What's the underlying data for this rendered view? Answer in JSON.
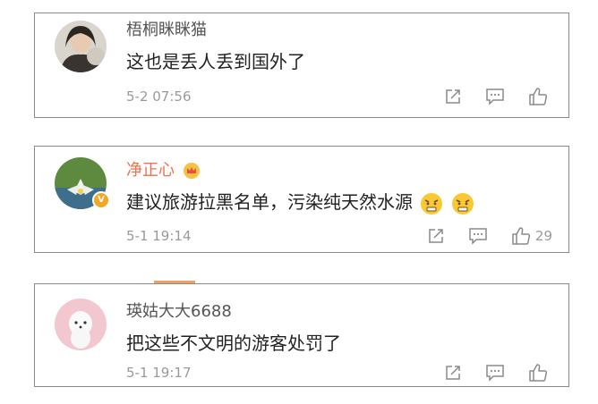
{
  "comments": [
    {
      "username": "梧桐眯眯猫",
      "text": "这也是丢人丢到国外了",
      "time": "5-2 07:56",
      "likes": ""
    },
    {
      "username": "净正心",
      "text": "建议旅游拉黑名单，污染纯天然水源",
      "time": "5-1 19:14",
      "likes": "29"
    },
    {
      "username": "瑛姑大大6688",
      "text": "把这些不文明的游客处罚了",
      "time": "5-1 19:17",
      "likes": ""
    }
  ],
  "colors": {
    "vip_name": "#eb7350",
    "text": "#222222",
    "meta": "#9a9a9a",
    "border": "#8a8a8a"
  },
  "icons": [
    "share-icon",
    "comment-icon",
    "like-icon",
    "crown-icon",
    "verified-badge-icon",
    "angry-emoji-icon"
  ]
}
